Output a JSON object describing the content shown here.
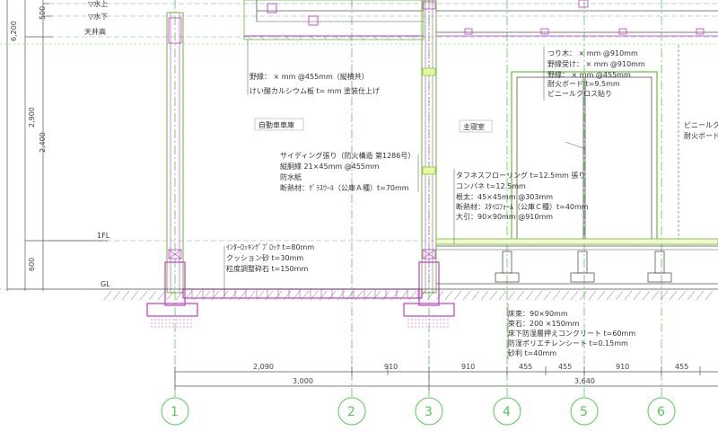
{
  "levels": {
    "water_top": "▽水上",
    "water_bottom": "▽水下",
    "ceiling": "天井高",
    "first_floor": "1FL",
    "ground": "GL"
  },
  "vertical_dims": [
    "500",
    "6,200",
    "2,900",
    "2,400",
    "600"
  ],
  "rooms": {
    "garage": "自動車車庫",
    "main": "主寝室"
  },
  "notes": {
    "garage_ceiling": [
      "野縁：  × mm @455mm（縦横共）",
      "けい酸カルシウム板 t=   mm 塗装仕上げ"
    ],
    "garage_wall": [
      "サイディング張り（防火構造 第1286号）",
      "縦胴縁 21×45mm @455mm",
      "防水紙",
      "断熱材：ｸﾞﾗｽｳｰﾙ（公庫Ａ種）t=70mm"
    ],
    "garage_floor": [
      "ｲﾝﾀｰﾛｯｷﾝｸﾞﾌﾞﾛｯｸ t=80mm",
      "クッション砂 t=30mm",
      "粒度調整砕石 t=150mm"
    ],
    "room_ceiling": [
      "つり木：  × mm @910mm",
      "野縁受け：  × mm @910mm",
      "野縁：  × mm @455mm",
      "耐火ボード t=9.5mm",
      "ビニールクロス貼り"
    ],
    "room_floor": [
      "タフネスフローリング t=12.5mm 張り",
      "コンパネ t=12.5mm",
      "根太：45×45mm @303mm",
      "断熱材：ｽﾀｲﾛﾌｫｰﾑ（公庫Ｃ種）t=40mm",
      "大引：90×90mm @910mm"
    ],
    "under_floor": [
      "床束：90×90mm",
      "束石：200 ×150mm",
      "床下防湿層押えコンクリート t=60mm",
      "防湿ポリエチレンシート t=0.15mm",
      "砂利 t=40mm"
    ],
    "right_edge": [
      "ビニールク",
      "耐火ボード"
    ]
  },
  "horizontal_dims": {
    "row1": [
      "2,090",
      "910",
      "910",
      "455",
      "455",
      "910",
      "455"
    ],
    "row2": [
      "3,000",
      "3,640"
    ]
  },
  "grid_axes": [
    "1",
    "2",
    "3",
    "4",
    "5",
    "6"
  ],
  "colors": {
    "grid": "#55c855",
    "frame": "#7ec850",
    "slab": "#c33cc3",
    "dim": "#555555",
    "ink": "#333333"
  }
}
